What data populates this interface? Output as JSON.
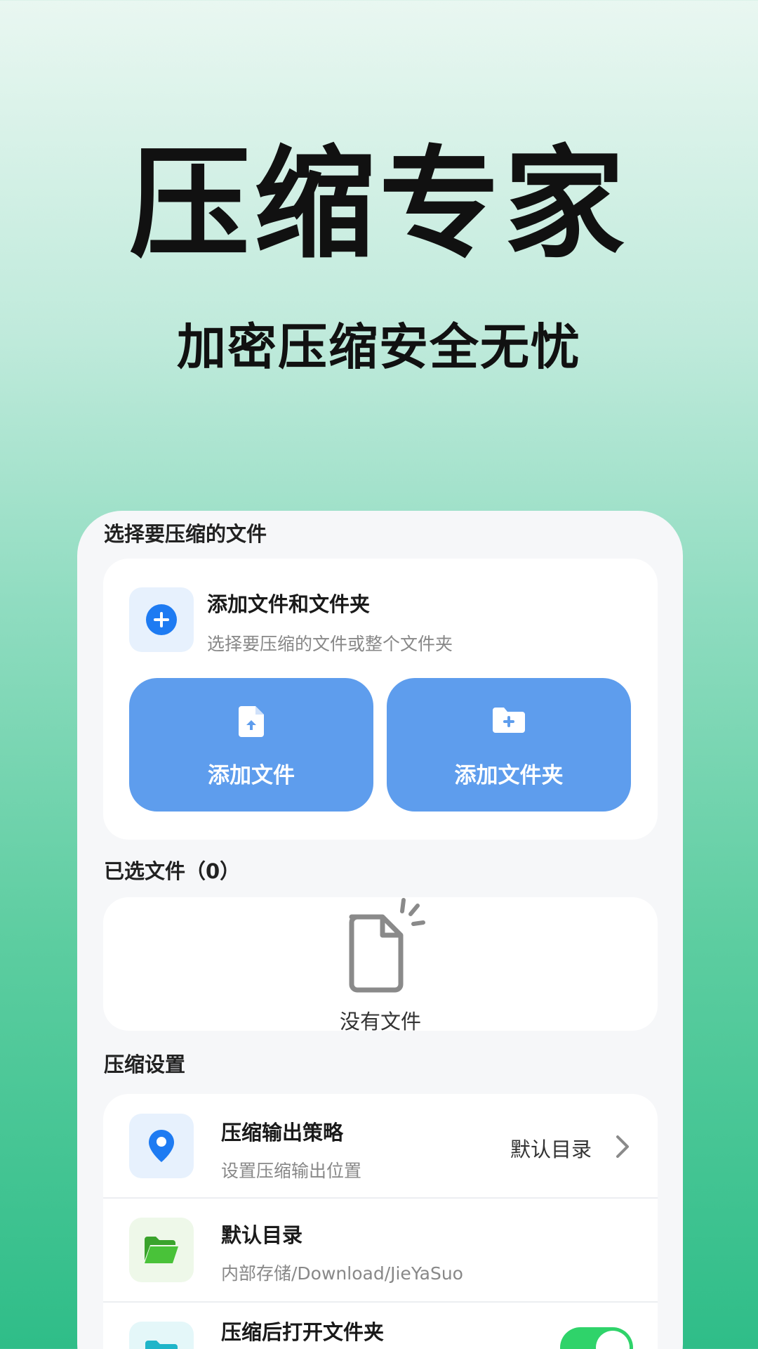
{
  "promo": {
    "title": "压缩专家",
    "subtitle": "加密压缩安全无忧"
  },
  "select_section": {
    "label": "选择要压缩的文件",
    "add_card": {
      "title": "添加文件和文件夹",
      "subtitle": "选择要压缩的文件或整个文件夹",
      "add_file_label": "添加文件",
      "add_folder_label": "添加文件夹"
    }
  },
  "selected_section": {
    "label": "已选文件（0）",
    "empty_text": "没有文件"
  },
  "settings_section": {
    "label": "压缩设置",
    "items": [
      {
        "title": "压缩输出策略",
        "subtitle": "设置压缩输出位置",
        "value": "默认目录"
      },
      {
        "title": "默认目录",
        "subtitle": "内部存储/Download/JieYaSuo"
      },
      {
        "title": "压缩后打开文件夹",
        "toggle_on": true
      }
    ]
  },
  "colors": {
    "accent_blue": "#5e9ded",
    "icon_blue": "#1e7bf2",
    "folder_green": "#49c239",
    "folder_teal": "#1fb5c9",
    "toggle_green": "#2fd36a"
  },
  "icons": [
    "plus-circle-icon",
    "file-upload-icon",
    "folder-add-icon",
    "empty-file-icon",
    "location-pin-icon",
    "chevron-right-icon",
    "folder-open-icon",
    "folder-icon"
  ]
}
